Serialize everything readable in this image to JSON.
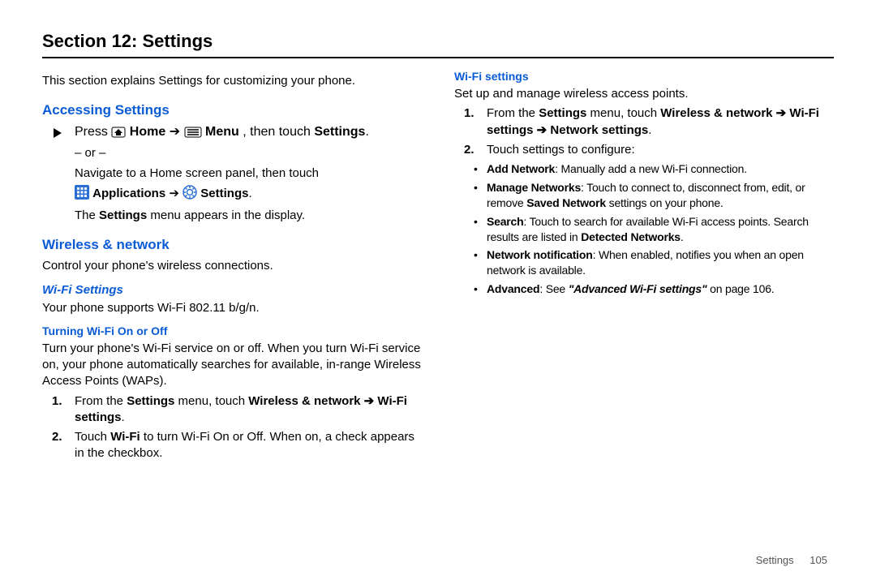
{
  "page_title": "Section 12: Settings",
  "intro": "This section explains Settings for customizing your phone.",
  "h_accessing": "Accessing Settings",
  "access_press": "Press ",
  "access_home": " Home",
  "arrow": " ➔ ",
  "access_menu": " Menu",
  "access_then": ", then touch ",
  "access_settings_word": "Settings",
  "access_or": "– or –",
  "access_nav": "Navigate to a Home screen panel, then touch",
  "access_apps": "Applications",
  "access_settings2": "Settings",
  "access_result_1": "The ",
  "access_result_2": "Settings",
  "access_result_3": " menu appears in the display.",
  "h_wireless": "Wireless & network",
  "wireless_intro": "Control your phone's wireless connections.",
  "h_wifi_settings": "Wi-Fi Settings",
  "wifi_support": "Your phone supports Wi-Fi 802.11 b/g/n.",
  "h_turning": "Turning Wi-Fi On or Off",
  "turning_body": "Turn your phone's Wi-Fi service on or off. When you turn Wi-Fi service on, your phone automatically searches for available, in-range Wireless Access Points (WAPs).",
  "t_step1_a": "From the ",
  "t_step1_b": "Settings",
  "t_step1_c": " menu, touch ",
  "t_step1_d": "Wireless & network ➔ Wi-Fi settings",
  "t_step2_a": "Touch ",
  "t_step2_b": "Wi-Fi",
  "t_step2_c": " to turn Wi-Fi On or Off. When on, a check appears in the checkbox.",
  "step1_num": "1.",
  "step2_num": "2.",
  "h_wifi_settings2": "Wi-Fi settings",
  "wifi2_intro": "Set up and manage wireless access points.",
  "w_step1_a": "From the ",
  "w_step1_b": "Settings",
  "w_step1_c": " menu, touch ",
  "w_step1_d": "Wireless & network ➔ Wi-Fi settings ➔ Network settings",
  "w_step2": "Touch settings to configure:",
  "b_add_label": "Add Network",
  "b_add_text": ": Manually add a new Wi-Fi connection.",
  "b_manage_label": "Manage Networks",
  "b_manage_text1": ": Touch to connect to, disconnect from, edit, or remove ",
  "b_manage_text2": "Saved Network",
  "b_manage_text3": " settings on your phone.",
  "b_search_label": "Search",
  "b_search_text1": ": Touch to search for available Wi-Fi access points. Search results are listed in ",
  "b_search_text2": "Detected Networks",
  "b_notify_label": "Network notification",
  "b_notify_text": ": When enabled, notifies you when an open network is available.",
  "b_adv_label": "Advanced",
  "b_adv_text1": ": See ",
  "b_adv_text2": "\"Advanced Wi-Fi settings\"",
  "b_adv_text3": " on page 106.",
  "footer_label": "Settings",
  "footer_page": "105"
}
